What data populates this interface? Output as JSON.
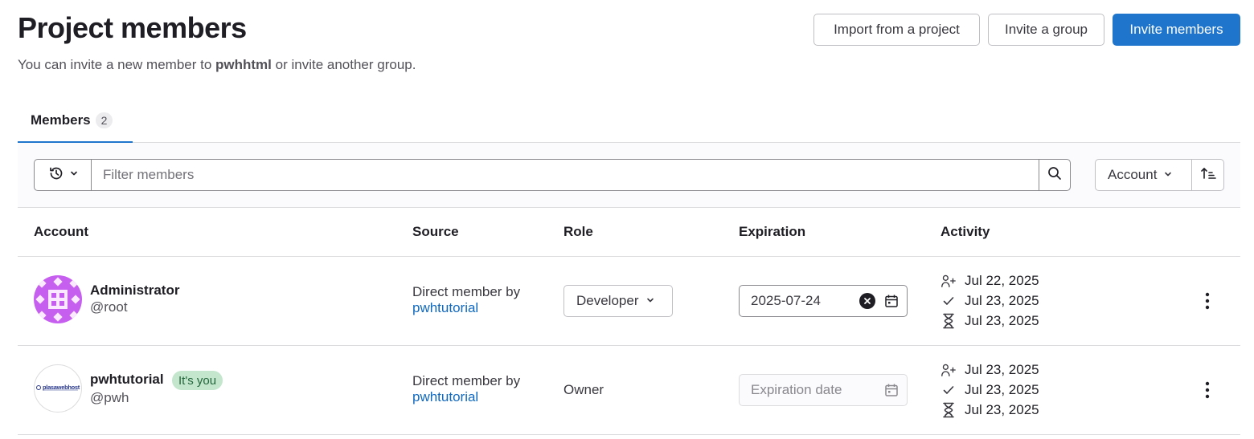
{
  "header": {
    "title": "Project members",
    "subtitle_prefix": "You can invite a new member to ",
    "project_name": "pwhhtml",
    "subtitle_suffix": " or invite another group.",
    "import_label": "Import from a project",
    "invite_group_label": "Invite a group",
    "invite_members_label": "Invite members"
  },
  "tabs": [
    {
      "label": "Members",
      "count": "2"
    }
  ],
  "filter": {
    "placeholder": "Filter members",
    "sort_label": "Account"
  },
  "table": {
    "columns": [
      "Account",
      "Source",
      "Role",
      "Expiration",
      "Activity"
    ],
    "rows": [
      {
        "name": "Administrator",
        "handle": "@root",
        "badge": "",
        "source_label": "Direct member by",
        "source_link": "pwhtutorial",
        "role": "Developer",
        "role_editable": true,
        "expiration": "2025-07-24",
        "expiration_placeholder": "",
        "activity": [
          "Jul 22, 2025",
          "Jul 23, 2025",
          "Jul 23, 2025"
        ]
      },
      {
        "name": "pwhtutorial",
        "handle": "@pwh",
        "badge": "It's you",
        "source_label": "Direct member by",
        "source_link": "pwhtutorial",
        "role": "Owner",
        "role_editable": false,
        "expiration": "",
        "expiration_placeholder": "Expiration date",
        "activity": [
          "Jul 23, 2025",
          "Jul 23, 2025",
          "Jul 23, 2025"
        ]
      }
    ]
  },
  "avatar_logo_text": "plasawebhost",
  "colors": {
    "primary": "#1f75cb",
    "link": "#1068bf",
    "avatar_admin": "#c65ef0",
    "badge_bg": "#c3e6cd",
    "badge_text": "#24663b"
  },
  "icons": {
    "history": "history-icon",
    "search": "search-icon",
    "sort_direction": "sort-ascending-icon",
    "calendar": "calendar-icon",
    "clear": "clear-icon",
    "user_added": "user-add-icon",
    "last_activity": "check-icon",
    "expires": "hourglass-icon",
    "more": "kebab-icon"
  }
}
